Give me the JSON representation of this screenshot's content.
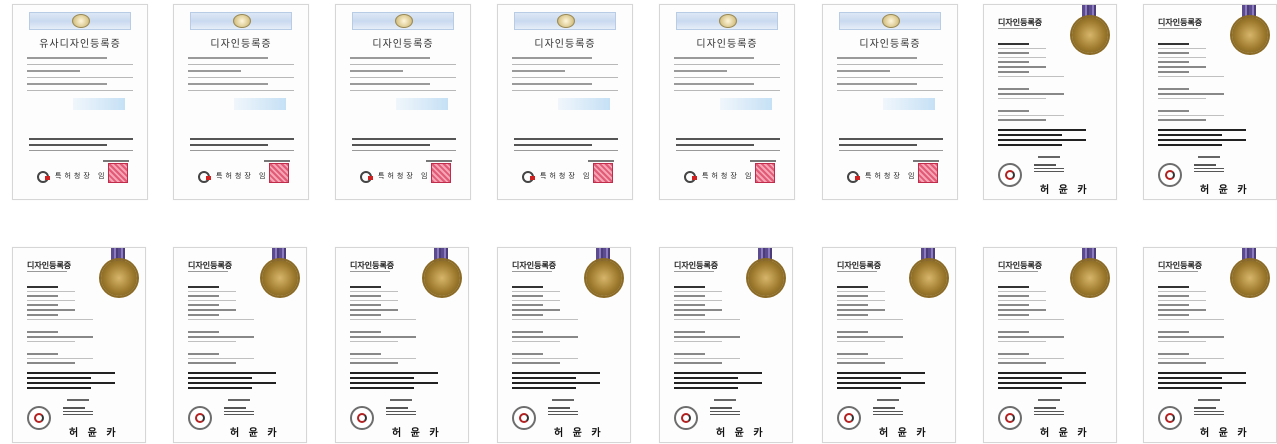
{
  "gallery": {
    "row1": [
      {
        "style": "old",
        "title": "유사디자인등록증",
        "issuer": "특허청장 임명"
      },
      {
        "style": "old",
        "title": "디자인등록증",
        "issuer": "특허청장 임명"
      },
      {
        "style": "old",
        "title": "디자인등록증",
        "issuer": "특허청장 임명"
      },
      {
        "style": "old",
        "title": "디자인등록증",
        "issuer": "특허청장 임명"
      },
      {
        "style": "old",
        "title": "디자인등록증",
        "issuer": "특허청장 임명"
      },
      {
        "style": "old",
        "title": "디자인등록증",
        "issuer": "특허청장 임명"
      },
      {
        "style": "new",
        "title": "디자인등록증",
        "signature": "허 윤 카"
      },
      {
        "style": "new",
        "title": "디자인등록증",
        "signature": "허 윤 카"
      }
    ],
    "row2": [
      {
        "style": "new",
        "title": "디자인등록증",
        "signature": "허 윤 카"
      },
      {
        "style": "new",
        "title": "디자인등록증",
        "signature": "허 윤 카"
      },
      {
        "style": "new",
        "title": "디자인등록증",
        "signature": "허 윤 카"
      },
      {
        "style": "new",
        "title": "디자인등록증",
        "signature": "허 윤 카"
      },
      {
        "style": "new",
        "title": "디자인등록증",
        "signature": "허 윤 카"
      },
      {
        "style": "new",
        "title": "디자인등록증",
        "signature": "허 윤 카"
      },
      {
        "style": "new",
        "title": "디자인등록증",
        "signature": "허 윤 카"
      },
      {
        "style": "new",
        "title": "디자인등록증",
        "signature": "허 윤 카"
      }
    ]
  }
}
